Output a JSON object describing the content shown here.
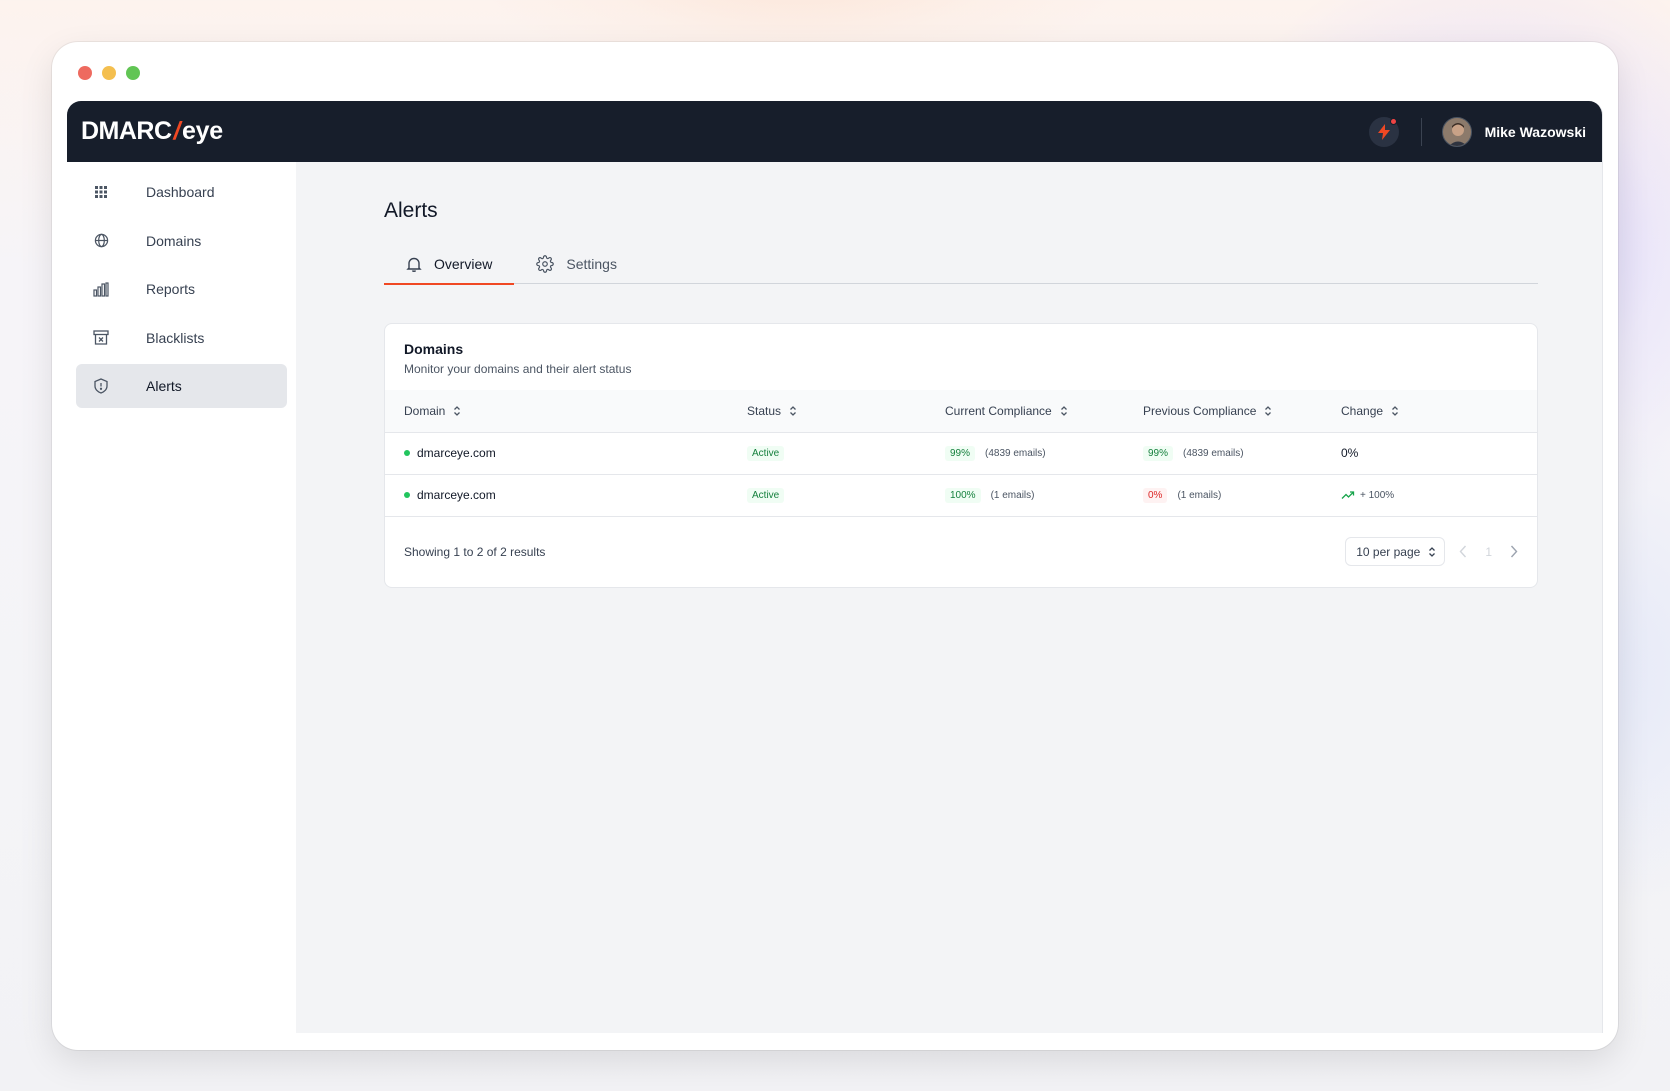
{
  "brand": {
    "logo_left": "DMARC",
    "logo_slash": "/",
    "logo_right": "eye",
    "accent": "#f04823",
    "topbar_bg": "#171e2b"
  },
  "user": {
    "name": "Mike Wazowski",
    "notification_icon": "bolt-icon"
  },
  "sidebar": {
    "items": [
      {
        "label": "Dashboard",
        "icon": "grid-icon"
      },
      {
        "label": "Domains",
        "icon": "globe-icon"
      },
      {
        "label": "Reports",
        "icon": "bar-chart-icon"
      },
      {
        "label": "Blacklists",
        "icon": "archive-x-icon"
      },
      {
        "label": "Alerts",
        "icon": "shield-icon",
        "active": true
      }
    ]
  },
  "page": {
    "title": "Alerts"
  },
  "tabs": [
    {
      "label": "Overview",
      "icon": "bell-icon",
      "active": true
    },
    {
      "label": "Settings",
      "icon": "gear-icon"
    }
  ],
  "card": {
    "title": "Domains",
    "subtitle": "Monitor your domains and their alert status",
    "columns": [
      "Domain",
      "Status",
      "Current Compliance",
      "Previous Compliance",
      "Change"
    ],
    "rows": [
      {
        "domain": "dmarceye.com",
        "status": "Active",
        "current_pct": "99%",
        "current_emails": "(4839 emails)",
        "previous_pct": "99%",
        "previous_emails": "(4839 emails)",
        "change": "0%"
      },
      {
        "domain": "dmarceye.com",
        "status": "Active",
        "current_pct": "100%",
        "current_emails": "(1 emails)",
        "previous_pct": "0%",
        "previous_emails": "(1 emails)",
        "change": "+ 100%"
      }
    ],
    "footer": {
      "results": "Showing 1 to 2 of 2 results",
      "per_page": "10 per page",
      "page": "1"
    }
  }
}
